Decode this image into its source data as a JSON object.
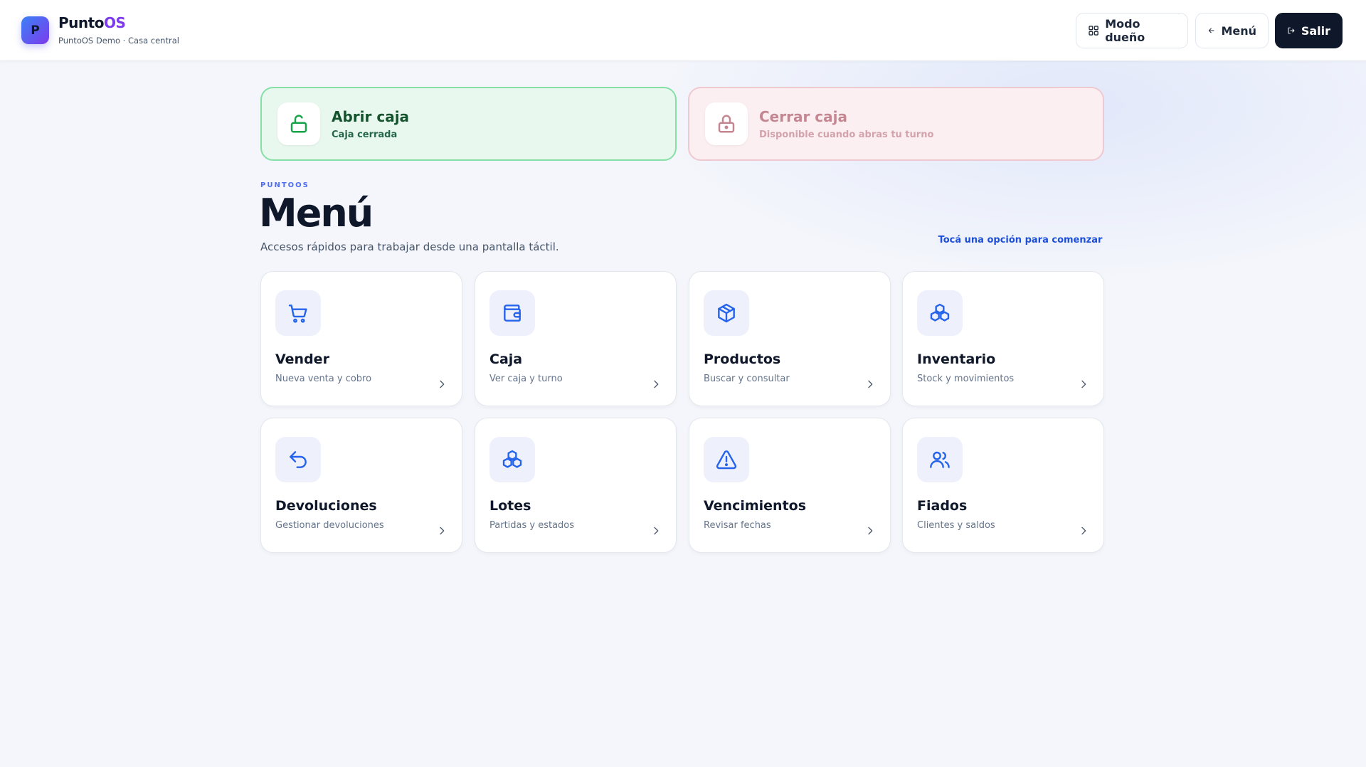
{
  "header": {
    "logo_letter": "P",
    "brand_main": "Punto",
    "brand_accent": "OS",
    "subtitle": "PuntoOS Demo · Casa central",
    "buttons": {
      "owner_mode": "Modo dueño",
      "menu": "Menú",
      "exit": "Salir"
    }
  },
  "caja": {
    "open": {
      "title": "Abrir caja",
      "status": "Caja cerrada",
      "icon": "lock-open-icon"
    },
    "close": {
      "title": "Cerrar caja",
      "status": "Disponible cuando abras tu turno",
      "icon": "lock-icon"
    }
  },
  "section": {
    "eyebrow": "PUNTOOS",
    "title": "Menú",
    "subtitle": "Accesos rápidos para trabajar desde una pantalla táctil.",
    "hint": "Tocá una opción para comenzar"
  },
  "tiles": [
    {
      "title": "Vender",
      "subtitle": "Nueva venta y cobro",
      "icon": "cart-icon"
    },
    {
      "title": "Caja",
      "subtitle": "Ver caja y turno",
      "icon": "wallet-icon"
    },
    {
      "title": "Productos",
      "subtitle": "Buscar y consultar",
      "icon": "box-icon"
    },
    {
      "title": "Inventario",
      "subtitle": "Stock y movimientos",
      "icon": "boxes-icon"
    },
    {
      "title": "Devoluciones",
      "subtitle": "Gestionar devoluciones",
      "icon": "undo-icon"
    },
    {
      "title": "Lotes",
      "subtitle": "Partidas y estados",
      "icon": "boxes-icon"
    },
    {
      "title": "Vencimientos",
      "subtitle": "Revisar fechas",
      "icon": "warning-icon"
    },
    {
      "title": "Fiados",
      "subtitle": "Clientes y saldos",
      "icon": "users-icon"
    }
  ],
  "colors": {
    "accent": "#4f6df5",
    "icon_blue": "#2563eb",
    "open_green": "#16a34a",
    "close_red": "#c48792",
    "dark": "#0f172a"
  }
}
